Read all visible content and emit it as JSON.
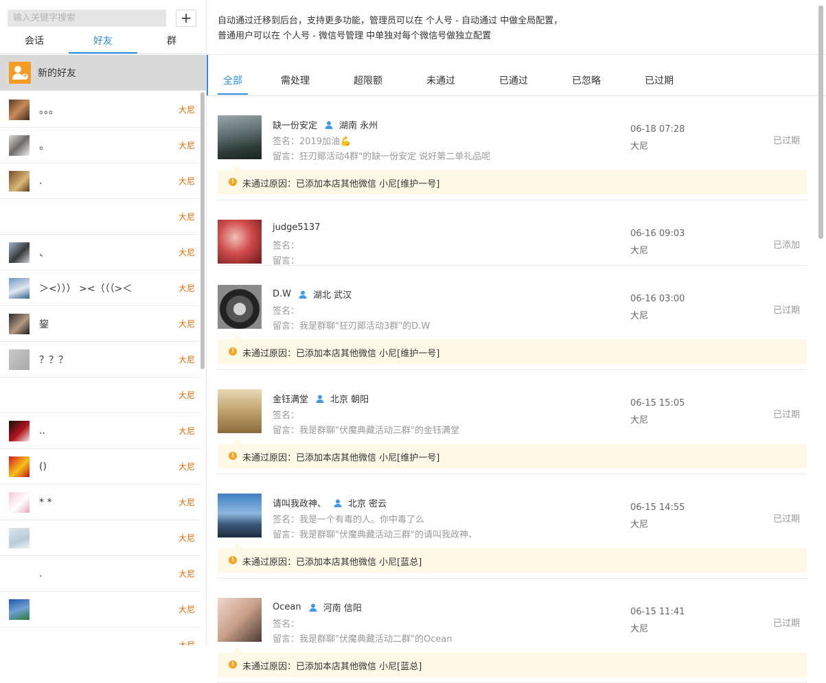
{
  "search": {
    "placeholder": "输入关键字搜索",
    "add_label": "+"
  },
  "side_tabs": [
    "会话",
    "好友",
    "群"
  ],
  "new_friend_label": "新的好友",
  "contacts": [
    {
      "name": "。。。",
      "tag": "大尼"
    },
    {
      "name": "。",
      "tag": "大尼"
    },
    {
      "name": ".",
      "tag": "大尼"
    },
    {
      "name": "",
      "tag": "大尼"
    },
    {
      "name": "、",
      "tag": "大尼"
    },
    {
      "name": "＞<））） ><（（（>＜",
      "tag": "大尼"
    },
    {
      "name": "鋆",
      "tag": "大尼"
    },
    {
      "name": "？？？",
      "tag": "大尼"
    },
    {
      "name": "",
      "tag": "大尼"
    },
    {
      "name": "..",
      "tag": "大尼"
    },
    {
      "name": "()",
      "tag": "大尼"
    },
    {
      "name": "* *",
      "tag": "大尼"
    },
    {
      "name": "",
      "tag": "大尼"
    },
    {
      "name": ".",
      "tag": "大尼"
    },
    {
      "name": "",
      "tag": "大尼"
    },
    {
      "name": "",
      "tag": "大尼"
    }
  ],
  "notice": {
    "line1": "自动通过迁移到后台，支持更多功能，管理员可以在 个人号 - 自动通过 中做全局配置，",
    "line2": "普通用户可以在 个人号 - 微信号管理 中单独对每个微信号做独立配置"
  },
  "tabs": [
    "全部",
    "需处理",
    "超限额",
    "未通过",
    "已通过",
    "已忽略",
    "已过期"
  ],
  "labels": {
    "sig": "签名：",
    "msg": "留言：",
    "reason": "未通过原因："
  },
  "requests": [
    {
      "name": "缺一份安定",
      "location": "湖南 永州",
      "signature": "2019加油💪",
      "message": "狂刃鄮活动4群\"的缺一份安定 说好第二单礼品呢",
      "time": "06-18 07:28",
      "owner": "大尼",
      "status": "已过期",
      "reason": "已添加本店其他微信 小尼[维护一号]"
    },
    {
      "name": "judge5137",
      "location": "",
      "signature": "",
      "message": "",
      "time": "06-16 09:03",
      "owner": "大尼",
      "status": "已添加",
      "reason": ""
    },
    {
      "name": "D.W",
      "location": "湖北 武汉",
      "signature": "",
      "message": "我是群聊\"狂刃鄮活动3群\"的D.W",
      "time": "06-16 03:00",
      "owner": "大尼",
      "status": "已过期",
      "reason": "已添加本店其他微信 小尼[维护一号]"
    },
    {
      "name": "金钰满堂",
      "location": "北京 朝阳",
      "signature": "",
      "message": "我是群聊\"伏魔典藏活动三群\"的金钰满堂",
      "time": "06-15 15:05",
      "owner": "大尼",
      "status": "已过期",
      "reason": "已添加本店其他微信 小尼[维护一号]"
    },
    {
      "name": "请叫我政神、",
      "location": "北京 密云",
      "signature": "我是一个有毒的人。你中毒了么",
      "message": "我是群聊\"伏魔典藏活动三群\"的请叫我政神、",
      "time": "06-15 14:55",
      "owner": "大尼",
      "status": "已过期",
      "reason": "已添加本店其他微信 小尼[蓝总]"
    },
    {
      "name": "Ocean",
      "location": "河南 信阳",
      "signature": "",
      "message": "我是群聊\"伏魔典藏活动二群\"的Ocean",
      "time": "06-15 11:41",
      "owner": "大尼",
      "status": "已过期",
      "reason": "已添加本店其他微信 小尼[蓝总]"
    }
  ],
  "colors": {
    "accent": "#2b8ce8",
    "tag": "#e06a00",
    "warning": "#f5a623",
    "reason_bg": "#fef8e7"
  }
}
